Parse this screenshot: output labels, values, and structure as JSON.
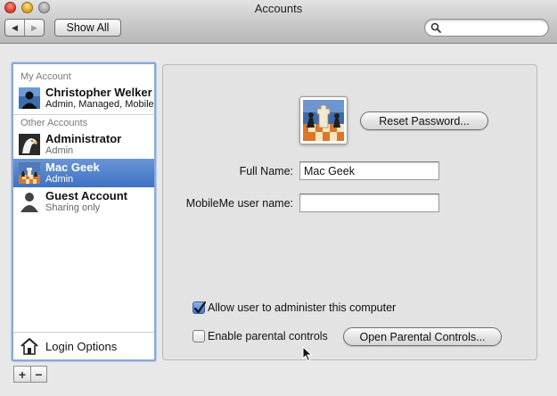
{
  "window": {
    "title": "Accounts",
    "show_all_label": "Show All",
    "back_label": "◀",
    "forward_label": "▶",
    "search_placeholder": ""
  },
  "sidebar": {
    "my_account_header": "My Account",
    "other_accounts_header": "Other Accounts",
    "accounts": [
      {
        "name": "Christopher Welker",
        "role": "Admin, Managed, Mobile",
        "picture": "person-silhouette-icon"
      },
      {
        "name": "Administrator",
        "role": "Admin",
        "picture": "eagle-icon"
      },
      {
        "name": "Mac Geek",
        "role": "Admin",
        "picture": "chess-icon",
        "selected": true
      },
      {
        "name": "Guest Account",
        "role": "Sharing only",
        "picture": "guest-silhouette-icon"
      }
    ],
    "login_options_label": "Login Options",
    "add_label": "+",
    "remove_label": "−"
  },
  "detail": {
    "reset_password_label": "Reset Password...",
    "full_name_label": "Full Name:",
    "full_name_value": "Mac Geek",
    "mobileme_label": "MobileMe user name:",
    "mobileme_value": "",
    "allow_admin_label": "Allow user to administer this computer",
    "allow_admin_checked": true,
    "parental_label": "Enable parental controls",
    "parental_checked": false,
    "open_parental_label": "Open Parental Controls..."
  },
  "colors": {
    "selection": "#3e72c4",
    "sidebar_focus": "#8aa9d7",
    "close_button": "#d8382d",
    "minimize_button": "#d6a215"
  }
}
